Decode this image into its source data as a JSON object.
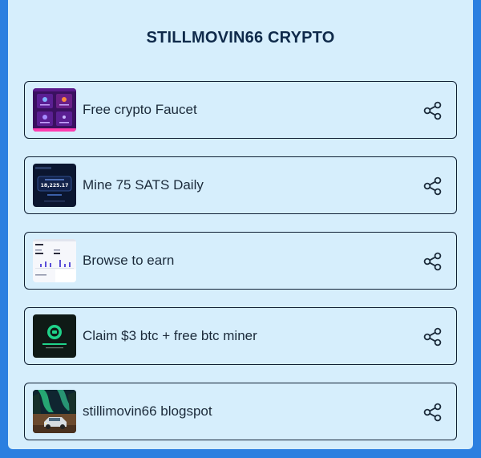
{
  "page": {
    "title": "STILLMOVIN66 CRYPTO"
  },
  "links": [
    {
      "label": "Free crypto Faucet",
      "thumbnail": "faucet-app-thumbnail"
    },
    {
      "label": "Mine 75 SATS Daily",
      "thumbnail": "mining-balance-thumbnail",
      "thumbnail_text": "18,225.17"
    },
    {
      "label": "Browse to earn",
      "thumbnail": "browser-dashboard-thumbnail"
    },
    {
      "label": "Claim $3 btc + free btc miner",
      "thumbnail": "btc-miner-promo-thumbnail"
    },
    {
      "label": "stillimovin66 blogspot",
      "thumbnail": "aurora-car-photo-thumbnail"
    }
  ],
  "icons": {
    "share": "share-icon"
  },
  "colors": {
    "page_border": "#2b7fe0",
    "background": "#d6eefc",
    "card_border": "#0f1f33",
    "title_text": "#0f2a4a",
    "label_text": "#1b2a3a"
  }
}
